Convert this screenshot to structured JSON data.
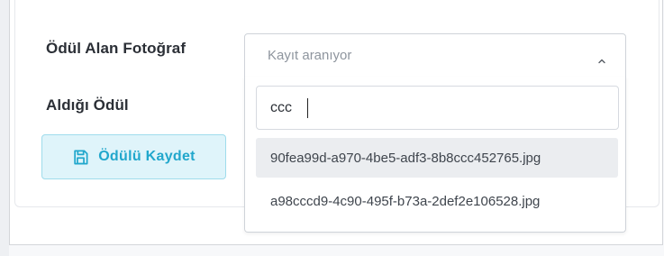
{
  "form": {
    "photo_label": "Ödül Alan Fotoğraf",
    "award_label": "Aldığı Ödül",
    "save_button_label": "Ödülü Kaydet"
  },
  "photo_select": {
    "selected_text": "Kayıt aranıyor",
    "search_value": "ccc",
    "options": [
      {
        "label": "90fea99d-a970-4be5-adf3-8b8ccc452765.jpg",
        "highlighted": true
      },
      {
        "label": "a98cccd9-4c90-495f-b73a-2def2e106528.jpg",
        "highlighted": false
      }
    ]
  },
  "icons": {
    "save": "floppy-disk-icon",
    "select_toggle": "chevron-up-icon"
  },
  "colors": {
    "save_button_bg": "#dff4fa",
    "save_button_border": "#9fdcec",
    "save_button_text": "#21a7cc",
    "option_highlight": "#ebedf0"
  }
}
